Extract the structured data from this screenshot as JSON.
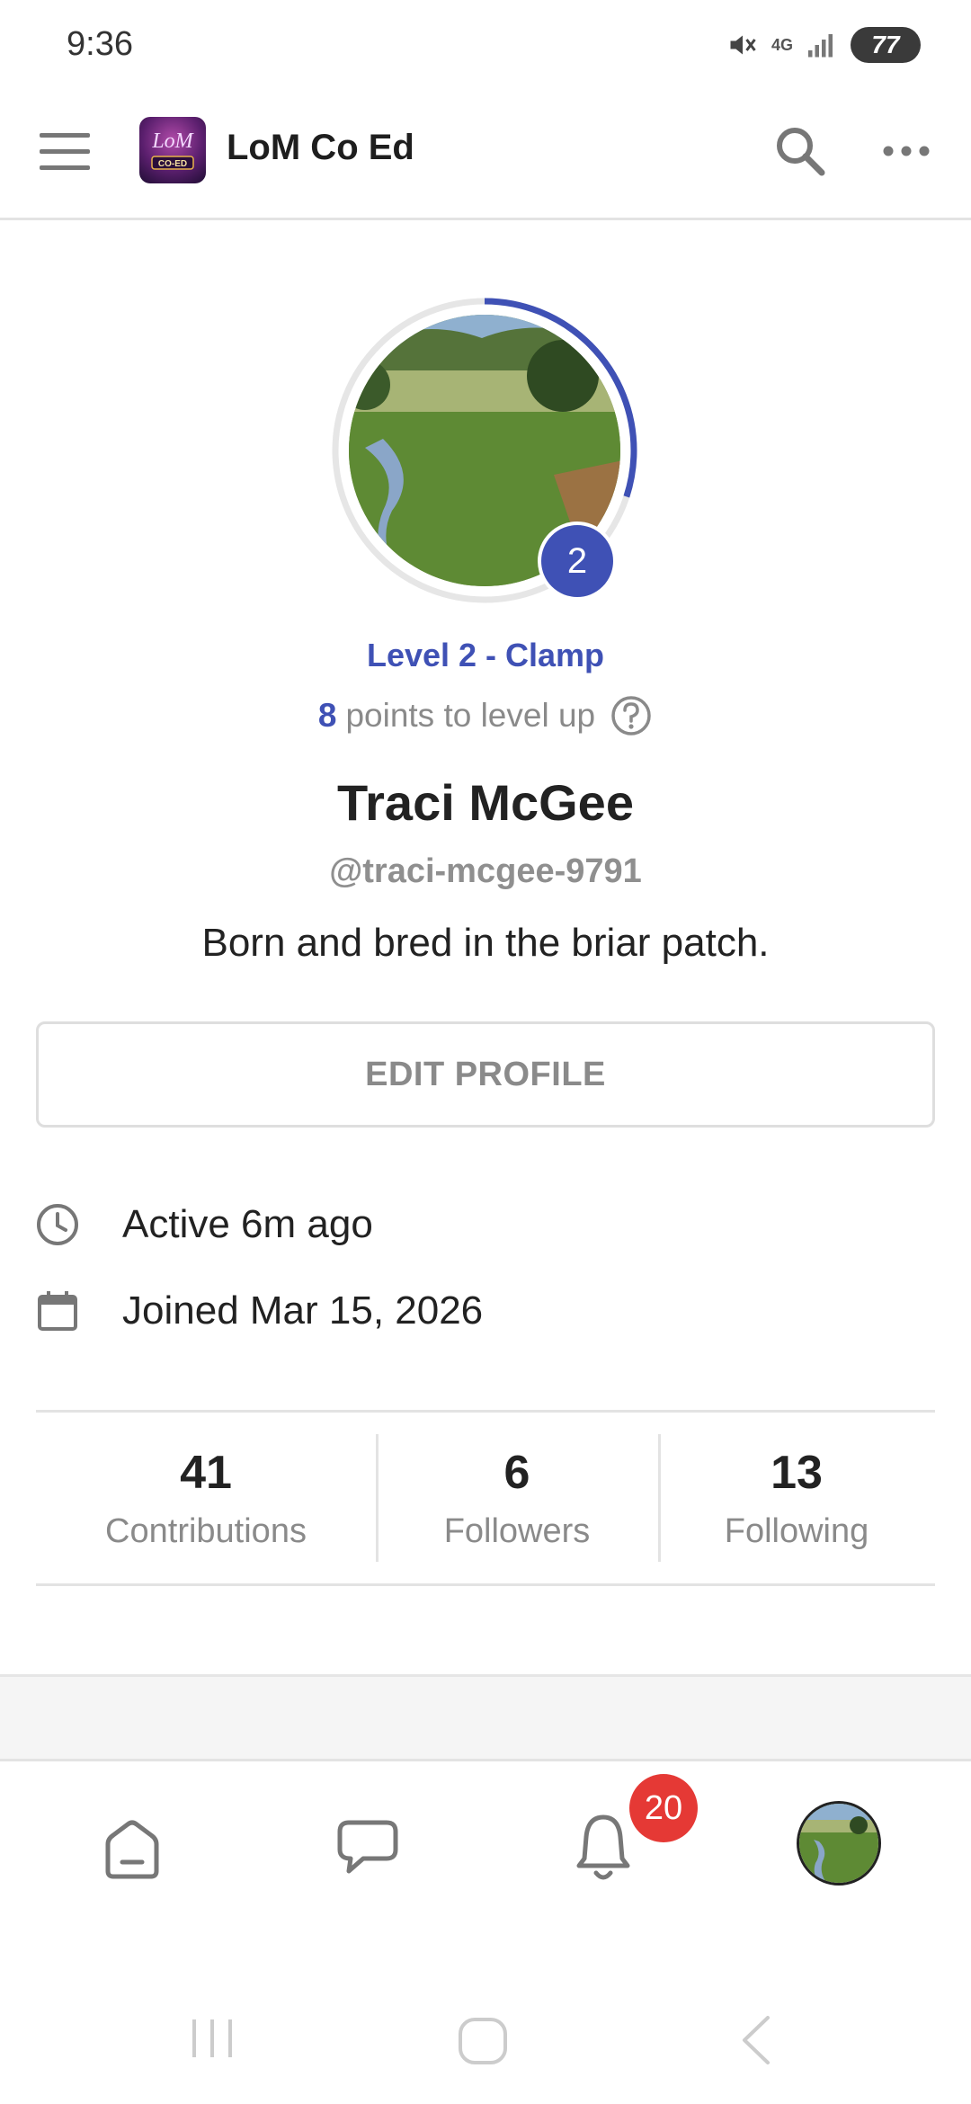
{
  "status_bar": {
    "time": "9:36",
    "network": "4G",
    "battery": "77"
  },
  "header": {
    "app_name": "LoM Co Ed",
    "logo_text_top": "LoM",
    "logo_text_bottom": "CO-ED"
  },
  "profile": {
    "level_number": "2",
    "level_title": "Level 2 - Clamp",
    "points_number": "8",
    "points_text": "points to level up",
    "level_progress": 0.3,
    "name": "Traci McGee",
    "handle": "@traci-mcgee-9791",
    "bio": "Born and bred in the briar patch.",
    "edit_button": "EDIT PROFILE",
    "active": "Active 6m ago",
    "joined": "Joined Mar 15, 2026"
  },
  "stats": [
    {
      "value": "41",
      "label": "Contributions"
    },
    {
      "value": "6",
      "label": "Followers"
    },
    {
      "value": "13",
      "label": "Following"
    }
  ],
  "bottom_nav": {
    "notification_count": "20"
  },
  "colors": {
    "accent": "#3f51b5",
    "badge_red": "#e53935",
    "muted_text": "#8a8a8a"
  },
  "icons": [
    "menu-icon",
    "search-icon",
    "more-icon",
    "help-icon",
    "clock-icon",
    "calendar-icon",
    "home-icon",
    "chat-icon",
    "bell-icon"
  ]
}
